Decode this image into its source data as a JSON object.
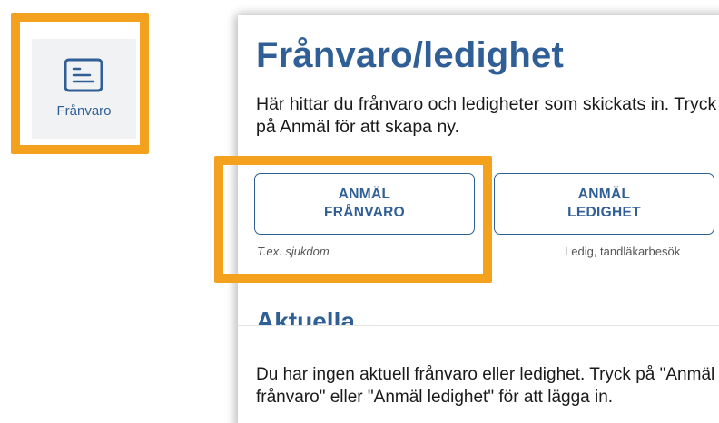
{
  "nav": {
    "label": "Frånvaro",
    "icon": "list-document-icon"
  },
  "page": {
    "title": "Frånvaro/ledighet",
    "intro": "Här hittar du frånvaro och ledigheter som skickats in. Tryck på Anmäl för att skapa ny."
  },
  "actions": {
    "report_absence": {
      "line1": "ANMÄL",
      "line2": "FRÅNVARO",
      "hint": "T.ex. sjukdom"
    },
    "report_leave": {
      "line1": "ANMÄL",
      "line2": "LEDIGHET",
      "hint": "Ledig, tandläkarbesök"
    }
  },
  "current": {
    "title": "Aktuella",
    "empty_text": "Du har ingen aktuell frånvaro eller ledighet. Tryck på \"Anmäl frånvaro\" eller \"Anmäl ledighet\" för att lägga in."
  },
  "colors": {
    "accent": "#2f5f96",
    "highlight": "#f4a11e",
    "tile_bg": "#f1f2f4"
  }
}
